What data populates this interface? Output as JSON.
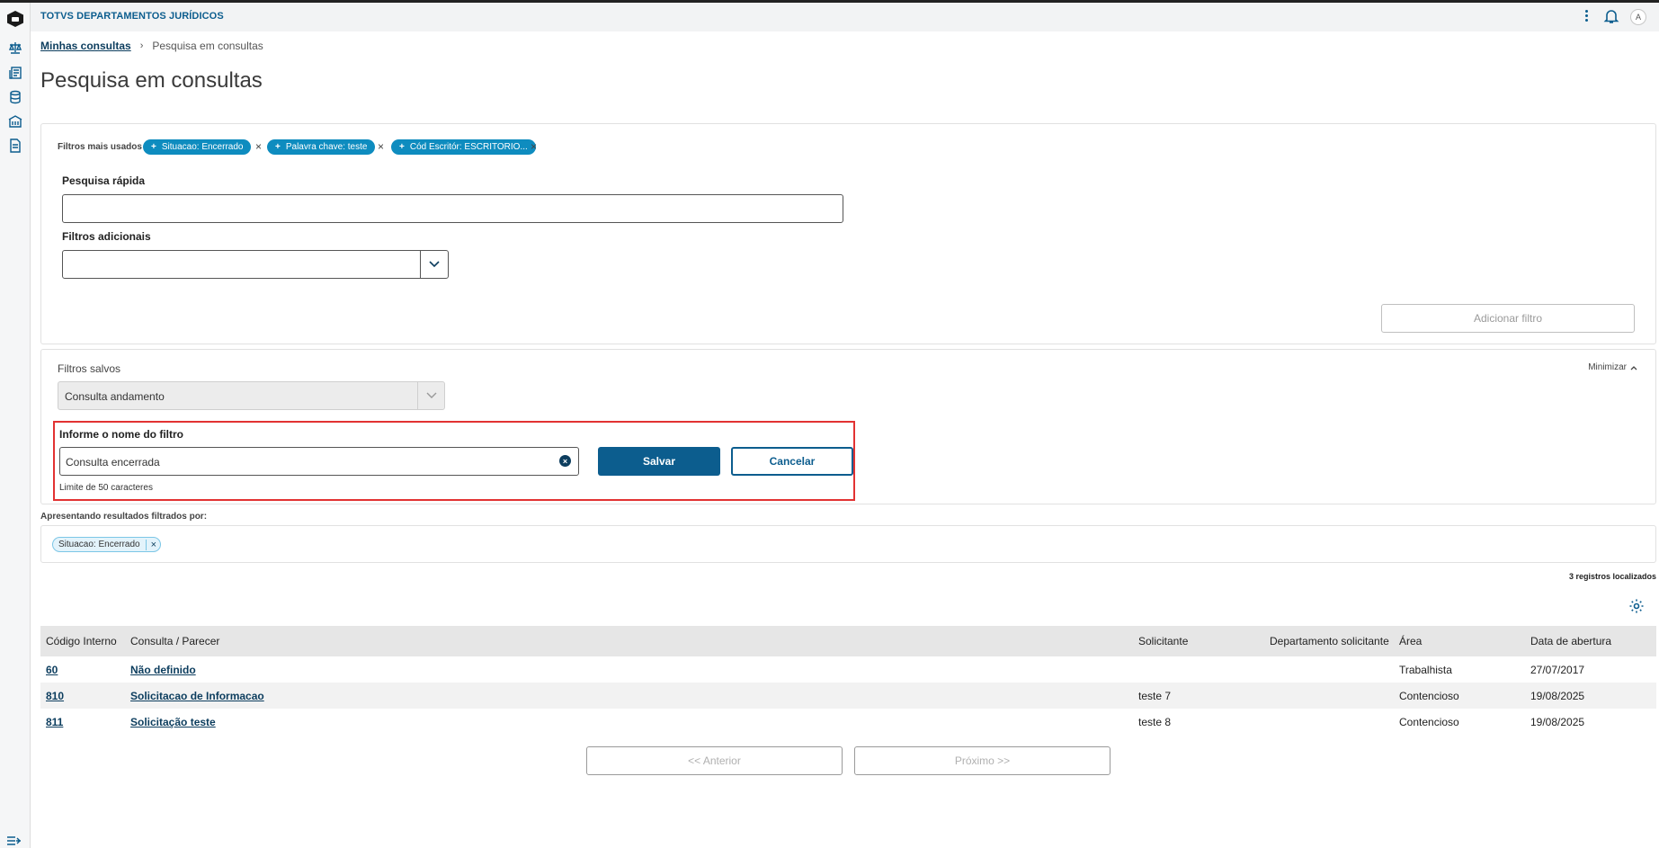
{
  "header": {
    "app_title": "TOTVS DEPARTAMENTOS JURÍDICOS",
    "avatar_initial": "A"
  },
  "sidebar": {
    "items": [
      {
        "icon": "scale-icon"
      },
      {
        "icon": "document-list-icon"
      },
      {
        "icon": "database-icon"
      },
      {
        "icon": "building-icon"
      },
      {
        "icon": "file-icon"
      }
    ],
    "collapse_icon": "collapse-menu-icon"
  },
  "breadcrumb": {
    "parent": "Minhas consultas",
    "current": "Pesquisa em consultas"
  },
  "page": {
    "title": "Pesquisa em consultas"
  },
  "filters": {
    "most_used_label": "Filtros mais usados",
    "chips": [
      {
        "label": "Situacao: Encerrado"
      },
      {
        "label": "Palavra chave: teste"
      },
      {
        "label": "Cód Escritór: ESCRITORIO..."
      }
    ],
    "quick_search_label": "Pesquisa rápida",
    "quick_search_value": "",
    "additional_label": "Filtros adicionais",
    "add_filter_button": "Adicionar filtro"
  },
  "saved_filters": {
    "label": "Filtros salvos",
    "minimize": "Minimizar",
    "selected": "Consulta andamento",
    "name_label": "Informe o nome do filtro",
    "name_value": "Consulta encerrada",
    "save_button": "Salvar",
    "cancel_button": "Cancelar",
    "limit_hint": "Limite de 50 caracteres"
  },
  "results": {
    "label": "Apresentando resultados filtrados por:",
    "active_filter": "Situacao: Encerrado",
    "count_text": "3 registros localizados"
  },
  "table": {
    "columns": [
      "Código Interno",
      "Consulta / Parecer",
      "Solicitante",
      "Departamento solicitante",
      "Área",
      "Data de abertura"
    ],
    "rows": [
      {
        "code": "60",
        "consulta": "Não definido",
        "solicitante": "",
        "departamento": "",
        "area": "Trabalhista",
        "data": "27/07/2017"
      },
      {
        "code": "810",
        "consulta": "Solicitacao de Informacao",
        "solicitante": "teste 7",
        "departamento": "",
        "area": "Contencioso",
        "data": "19/08/2025"
      },
      {
        "code": "811",
        "consulta": "Solicitação teste",
        "solicitante": "teste 8",
        "departamento": "",
        "area": "Contencioso",
        "data": "19/08/2025"
      }
    ]
  },
  "pagination": {
    "prev": "<< Anterior",
    "next": "Próximo >>"
  },
  "colors": {
    "primary": "#0c5d8e",
    "chip": "#0e8cbf",
    "highlight_border": "#e23232"
  }
}
